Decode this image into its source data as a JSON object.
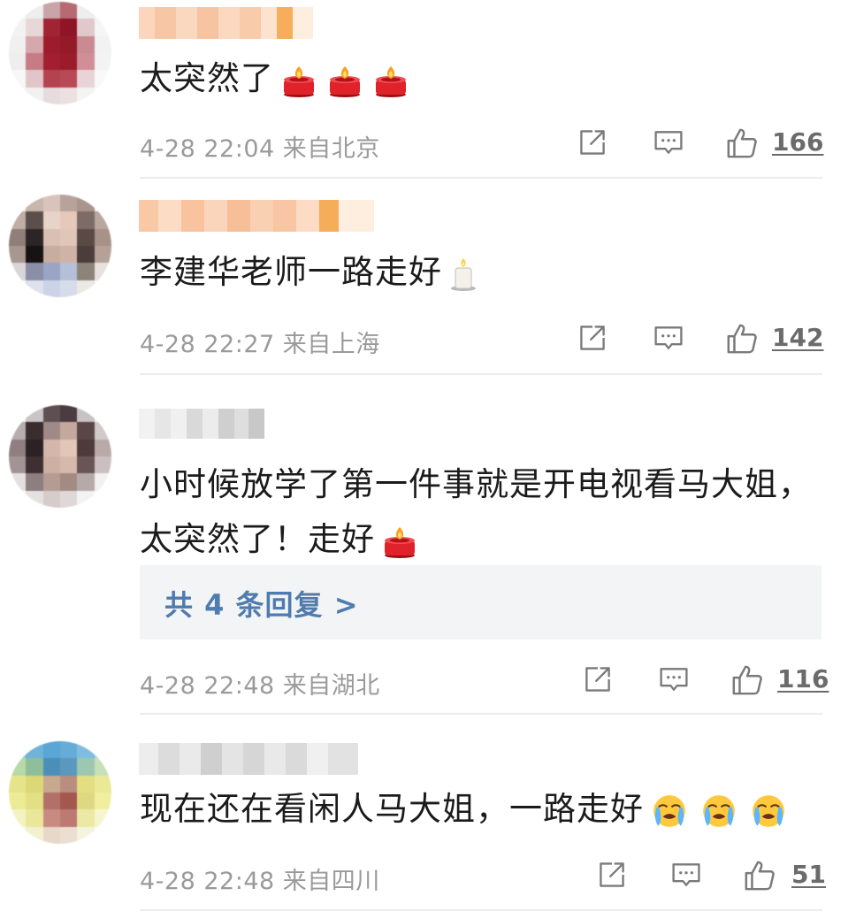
{
  "comments": [
    {
      "text": "太突然了",
      "emoji": [
        "candle-emoji",
        "candle-emoji",
        "candle-emoji"
      ],
      "time": "4-28 22:04",
      "location": "来自北京",
      "likes": "166"
    },
    {
      "text": "李建华老师一路走好",
      "emoji": [
        "white-candle-emoji"
      ],
      "time": "4-28 22:27",
      "location": "来自上海",
      "likes": "142"
    },
    {
      "text_line1": "小时候放学了第一件事就是开电视看马大姐，",
      "text_line2": "太突然了！走好",
      "emoji": [
        "candle-emoji"
      ],
      "reply_link": "共 4 条回复 >",
      "time": "4-28 22:48",
      "location": "来自湖北",
      "likes": "116"
    },
    {
      "text": "现在还在看闲人马大姐，一路走好",
      "emoji": [
        "crying-face-emoji",
        "crying-face-emoji",
        "crying-face-emoji"
      ],
      "time": "4-28 22:48",
      "location": "来自四川",
      "likes": "51"
    }
  ],
  "icons": {
    "share": "share-icon",
    "reply": "comment-icon",
    "like": "thumbs-up-icon"
  },
  "colors": {
    "link": "#4f7cae",
    "meta": "#9a9a9a",
    "reply_bg": "#f3f4f6"
  }
}
